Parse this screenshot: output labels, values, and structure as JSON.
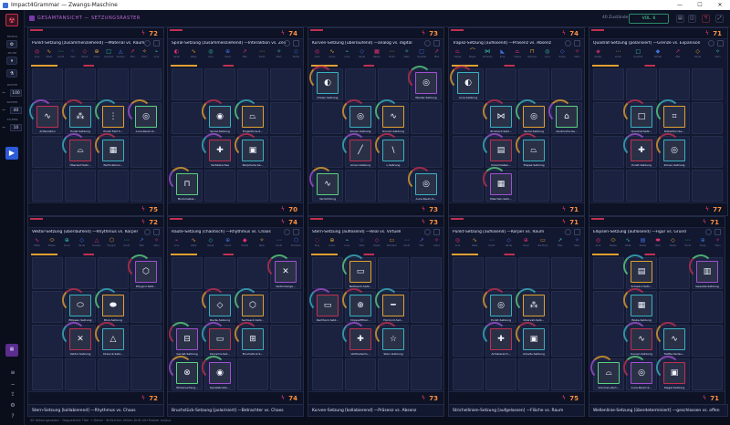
{
  "window": {
    "title": "Impact4Grammar — Zwangs-Maschine"
  },
  "topbar": {
    "title": "GESAMTANSICHT — SETZUNGSRASTER",
    "count": "40 Zustände",
    "vol": "VOL. 6"
  },
  "sidebar": {
    "l1": "MODUS",
    "l2": "PAUSE",
    "l3": "DICHTE",
    "v1": "100",
    "l4": "RASTER",
    "v2": "40",
    "l5": "STUFEN",
    "v3": "10"
  },
  "status": {
    "text": "40 Setzungsraster · Doppelklick Titel → Detail · Shift-Klick Zellen-Drift Alt+Raster an/aus"
  },
  "panels": [
    {
      "title": "Punkt-Setzung [zusammenziehend] —Material vs. Raum",
      "n": "72",
      "fn": "75",
      "tiles": [
        {
          "c": 4,
          "g": "∿",
          "l": "Artikulation"
        },
        {
          "c": 5,
          "g": "⁂",
          "l": "Punkt-Setzung"
        },
        {
          "c": 6,
          "g": "⋮",
          "l": "Punkt Feld S..."
        },
        {
          "c": 7,
          "g": "◎",
          "l": "Aura-Raum-S..."
        },
        {
          "c": 9,
          "g": "⌓",
          "l": "Überlauf-Setz..."
        },
        {
          "c": 10,
          "g": "▦",
          "l": "Perforations..."
        }
      ],
      "pal": [
        "◎",
        "∿",
        "⋯",
        "⁘",
        "◇",
        "⊕",
        "□",
        "◬",
        "↗",
        "✧",
        "⌁"
      ],
      "palL": [
        "Aura",
        "Welle",
        "Punkt",
        "Feld",
        "Raute",
        "Kreuz",
        "Quadrat",
        "Dreieck",
        "Pfeil",
        "Stern",
        "Linie"
      ]
    },
    {
      "title": "Spiral-Setzung [zusammenziehend] —Interaktion vs. Zeit",
      "n": "74",
      "fn": "70",
      "tiles": [
        {
          "c": 5,
          "g": "◉",
          "l": "Spiral-Setzung"
        },
        {
          "c": 6,
          "g": "⏢",
          "l": "Projektions-S..."
        },
        {
          "c": 9,
          "g": "✚",
          "l": "Vertikalachse"
        },
        {
          "c": 10,
          "g": "▣",
          "l": "Peripherie-Se..."
        },
        {
          "c": 12,
          "g": "⊓",
          "l": "Modulraster..."
        }
      ],
      "pal": [
        "◐",
        "∿",
        "◎",
        "⊕",
        "↗",
        "⋯",
        "✧",
        "◇"
      ],
      "palL": [
        "Spiral",
        "Welle",
        "Aura",
        "Kreuz",
        "Pfeil",
        "Punkt",
        "Stern",
        "Raute"
      ]
    },
    {
      "title": "Kurven-Setzung [überlaufend] —analog vs. digital",
      "n": "73",
      "fn": "73",
      "tiles": [
        {
          "c": 0,
          "g": "◐",
          "l": "Dreiec-Setzung"
        },
        {
          "c": 3,
          "g": "◎",
          "l": "Wisder-Setzung"
        },
        {
          "c": 5,
          "g": "◎",
          "l": "Zonen-Setzung"
        },
        {
          "c": 6,
          "g": "∿",
          "l": "Kurven-Setzung"
        },
        {
          "c": 9,
          "g": "╱",
          "l": "Linien-Setzung"
        },
        {
          "c": 10,
          "g": "\\",
          "l": "L-Setzung"
        },
        {
          "c": 12,
          "g": "∿",
          "l": "Verdichtung"
        },
        {
          "c": 15,
          "g": "◎",
          "l": "Aura-Raum-S..."
        }
      ],
      "pal": [
        "◎",
        "∿",
        "⌁",
        "◇",
        "▦",
        "⋯",
        "✧",
        "□",
        "↗"
      ],
      "palL": [
        "Aura",
        "Kurve",
        "Linie",
        "Raute",
        "Raster",
        "Punkt",
        "Stern",
        "Quadrat",
        "Pfeil"
      ]
    },
    {
      "title": "Trapez-Setzung [auflösend] —Präsenz vs. Absenz",
      "n": "74",
      "fn": "71",
      "tiles": [
        {
          "c": 0,
          "g": "◐",
          "l": "Aura-Setzung"
        },
        {
          "c": 5,
          "g": "⋈",
          "l": "Zickzack-Setz..."
        },
        {
          "c": 6,
          "g": "◎",
          "l": "Spiral-Setzung"
        },
        {
          "c": 7,
          "g": "⌂",
          "l": "Ausbruchs-Se..."
        },
        {
          "c": 9,
          "g": "▤",
          "l": "Umschließen..."
        },
        {
          "c": 10,
          "g": "⏢",
          "l": "Trapez-Setzung"
        },
        {
          "c": 13,
          "g": "▦",
          "l": "Maschen-Setz..."
        }
      ],
      "pal": [
        "⏢",
        "⌒",
        "⋈",
        "◣",
        "⏢",
        "⊓",
        "◎",
        "◇",
        "✧"
      ],
      "palL": [
        "Trapez",
        "Bogen",
        "Zickzack",
        "Ecke",
        "Trapez",
        "Rahmen",
        "Aura",
        "Raute",
        "Stern"
      ]
    },
    {
      "title": "Quadrat-Setzung [polarisiert] —Grenze vs. Expansion",
      "n": "71",
      "fn": "77",
      "tiles": [
        {
          "c": 5,
          "g": "□",
          "l": "Quadrat-Setz..."
        },
        {
          "c": 6,
          "g": "⌗",
          "l": "Kollektion-Se..."
        },
        {
          "c": 9,
          "g": "✚",
          "l": "Punkt-Setzung"
        },
        {
          "c": 10,
          "g": "◎",
          "l": "Zonen-Setzung"
        }
      ],
      "pal": [
        "◈",
        "⋯",
        "□",
        "◆",
        "↗",
        "◇",
        "✧"
      ],
      "palL": [
        "Raster",
        "Punkt",
        "Quadrat",
        "Würfel",
        "Pfeil",
        "Raute",
        "Stern"
      ]
    },
    {
      "title": "Vektor-Setzung [überlaufend] —Rhythmus vs. Körper",
      "n": "72",
      "fn": "72",
      "tiles": [
        {
          "c": 3,
          "g": "⬡",
          "l": "Polygon-Setz..."
        },
        {
          "c": 5,
          "g": "⬭",
          "l": "Ellipsen-Setzung"
        },
        {
          "c": 6,
          "g": "⬬",
          "l": "Blob-Setzung"
        },
        {
          "c": 9,
          "g": "✕",
          "l": "Vektor-Setzung"
        },
        {
          "c": 10,
          "g": "△",
          "l": "Dreieck-Setz..."
        }
      ],
      "pal": [
        "∿",
        "⬭",
        "⊕",
        "◇",
        "△",
        "⬡",
        "⋯",
        "↗",
        "✧"
      ],
      "palL": [
        "Welle",
        "Ellipse",
        "Kreuz",
        "Raute",
        "Dreieck",
        "Polygon",
        "Punkt",
        "Pfeil",
        "Stern"
      ]
    },
    {
      "title": "Raute-Setzung [chaotisch] —Rhythmus vs. Chaos",
      "n": "74",
      "fn": "74",
      "tiles": [
        {
          "c": 3,
          "g": "✕",
          "l": "Verbindungs..."
        },
        {
          "c": 5,
          "g": "◇",
          "l": "Raute-Setzung"
        },
        {
          "c": 6,
          "g": "⬡",
          "l": "Sechseck-Setz..."
        },
        {
          "c": 8,
          "g": "⊟",
          "l": "Gerüst-Setzung"
        },
        {
          "c": 9,
          "g": "▭",
          "l": "Diorama-Set..."
        },
        {
          "c": 10,
          "g": "⊞",
          "l": "Bruchstück-S..."
        },
        {
          "c": 12,
          "g": "⊗",
          "l": "Wirkenunfang..."
        },
        {
          "c": 13,
          "g": "◉",
          "l": "Spiralstruktu..."
        }
      ],
      "pal": [
        "⌁",
        "∿",
        "◇",
        "⊕",
        "◆",
        "✧",
        "⋯",
        "⬡"
      ],
      "palL": [
        "Linie",
        "Welle",
        "Raute",
        "Kreuz",
        "Würfel",
        "Stern",
        "Punkt",
        "Sechseck"
      ]
    },
    {
      "title": "Stern-Setzung [auflösend] —Real vs. Virtuell",
      "n": "73",
      "fn": "73",
      "tiles": [
        {
          "c": 1,
          "g": "▭",
          "l": "Netzwerk-Setz..."
        },
        {
          "c": 4,
          "g": "▭",
          "l": "Rechteck-Setz..."
        },
        {
          "c": 5,
          "g": "⊕",
          "l": "Doppelfiltrer..."
        },
        {
          "c": 6,
          "g": "━",
          "l": "Horizont-Set..."
        },
        {
          "c": 9,
          "g": "✚",
          "l": "Vertikalachs..."
        },
        {
          "c": 10,
          "g": "☆",
          "l": "Stern-Setzung"
        }
      ],
      "pal": [
        "◌",
        "⊕",
        "⌁",
        "☆",
        "◇",
        "▭",
        "⋯",
        "↗",
        "✧"
      ],
      "palL": [
        "Ring",
        "Kreuz",
        "Linie",
        "Stern",
        "Raute",
        "Rechteck",
        "Punkt",
        "Pfeil",
        "Glanz"
      ]
    },
    {
      "title": "Punkt-Setzung [auflösend] —Körper vs. Raum",
      "n": "71",
      "fn": "75",
      "tiles": [
        {
          "c": 5,
          "g": "◎",
          "l": "Punkt-Setzung"
        },
        {
          "c": 6,
          "g": "⁂",
          "l": "Intervall-Setz..."
        },
        {
          "c": 9,
          "g": "✚",
          "l": "Achsbereich..."
        },
        {
          "c": 10,
          "g": "▣",
          "l": "Arbeits-Setzung"
        }
      ],
      "pal": [
        "◎",
        "∿",
        "⋯",
        "◇",
        "⊕",
        "▭",
        "↗",
        "✧"
      ],
      "palL": [
        "Aura",
        "Welle",
        "Punkt",
        "Raute",
        "Kreuz",
        "Rechteck",
        "Pfeil",
        "Stern"
      ]
    },
    {
      "title": "Ellipsen-Setzung [auflösend] —Figur vs. Grund",
      "n": "71",
      "fn": "71",
      "tiles": [
        {
          "c": 1,
          "g": "▤",
          "l": "Schwarz-Setz..."
        },
        {
          "c": 3,
          "g": "▥",
          "l": "Gewebe-Setzung"
        },
        {
          "c": 5,
          "g": "▦",
          "l": "Wabe-Setzung"
        },
        {
          "c": 9,
          "g": "∿",
          "l": "Kurven-Setzung"
        },
        {
          "c": 10,
          "g": "∿",
          "l": "Treffer-Verlau..."
        },
        {
          "c": 12,
          "g": "⌓",
          "l": "Volumen-Kurt..."
        },
        {
          "c": 13,
          "g": "◎",
          "l": "Aura-Raum-S..."
        },
        {
          "c": 14,
          "g": "▣",
          "l": "Siegel-Setzung"
        }
      ],
      "pal": [
        "◎",
        "⬭",
        "∿",
        "▤",
        "⬬",
        "◇",
        "⋯",
        "⊕",
        "✧"
      ],
      "palL": [
        "Aura",
        "Ellipse",
        "Welle",
        "Raster",
        "Blob",
        "Raute",
        "Punkt",
        "Kreuz",
        "Stern"
      ]
    }
  ],
  "bottom": [
    "Stern-Setzung [kollabierend] —Rhythmus vs. Chaos",
    "Bruchstück-Setzung [polarisiert] —Betrachter vs. Chaos",
    "Kurven-Setzung [kollabierend] —Präsenz vs. Absenz",
    "Strichellinien-Setzung [aufgelassen] —Fläche vs. Raum",
    "Wellenlinie-Setzung [überdeterminiert] —geschlossen vs. offen"
  ]
}
